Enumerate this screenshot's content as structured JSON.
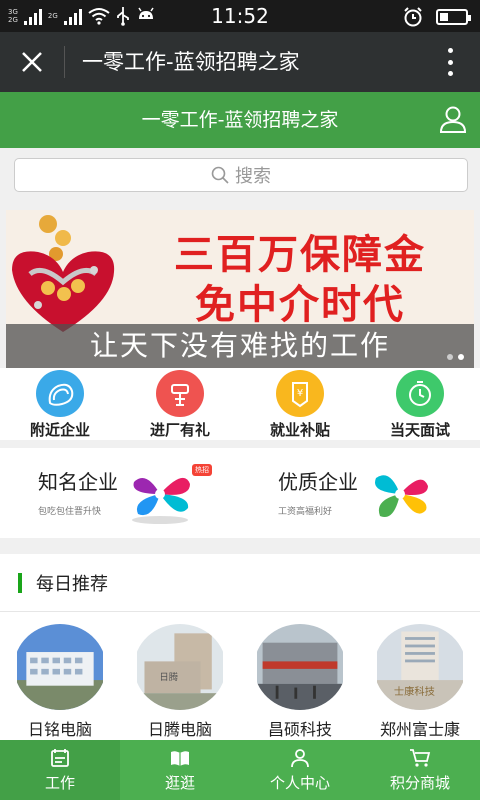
{
  "statusbar": {
    "time": "11:52",
    "network1": "3G",
    "network1b": "2G",
    "network2": "2G"
  },
  "wechat": {
    "title": "一零工作-蓝领招聘之家"
  },
  "header": {
    "title": "一零工作-蓝领招聘之家"
  },
  "search": {
    "placeholder": "搜索"
  },
  "banner": {
    "line1": "三百万保障金",
    "line2": "免中介时代",
    "line3": "让天下没有难找的工作"
  },
  "quick_menu": [
    {
      "label": "附近企业",
      "icon": "nearby-icon",
      "color": "#3aa9e8"
    },
    {
      "label": "进厂有礼",
      "icon": "gift-icon",
      "color": "#ef5350"
    },
    {
      "label": "就业补贴",
      "icon": "subsidy-icon",
      "color": "#f9b71e"
    },
    {
      "label": "当天面试",
      "icon": "clock-icon",
      "color": "#3ec96b"
    }
  ],
  "features": [
    {
      "title": "知名企业",
      "subtitle": "包吃包住晋升快",
      "badge": "热招"
    },
    {
      "title": "优质企业",
      "subtitle": "工资高福利好"
    }
  ],
  "recommend": {
    "title": "每日推荐",
    "companies": [
      {
        "name": "日铭电脑"
      },
      {
        "name": "日腾电脑"
      },
      {
        "name": "昌硕科技"
      },
      {
        "name": "郑州富士康"
      }
    ]
  },
  "bottom_nav": [
    {
      "label": "工作",
      "icon": "briefcase-icon"
    },
    {
      "label": "逛逛",
      "icon": "book-icon"
    },
    {
      "label": "个人中心",
      "icon": "person-icon"
    },
    {
      "label": "积分商城",
      "icon": "cart-icon"
    }
  ],
  "colors": {
    "brand_green": "#43a047",
    "nav_green": "#4caf50",
    "banner_red": "#e02020"
  }
}
